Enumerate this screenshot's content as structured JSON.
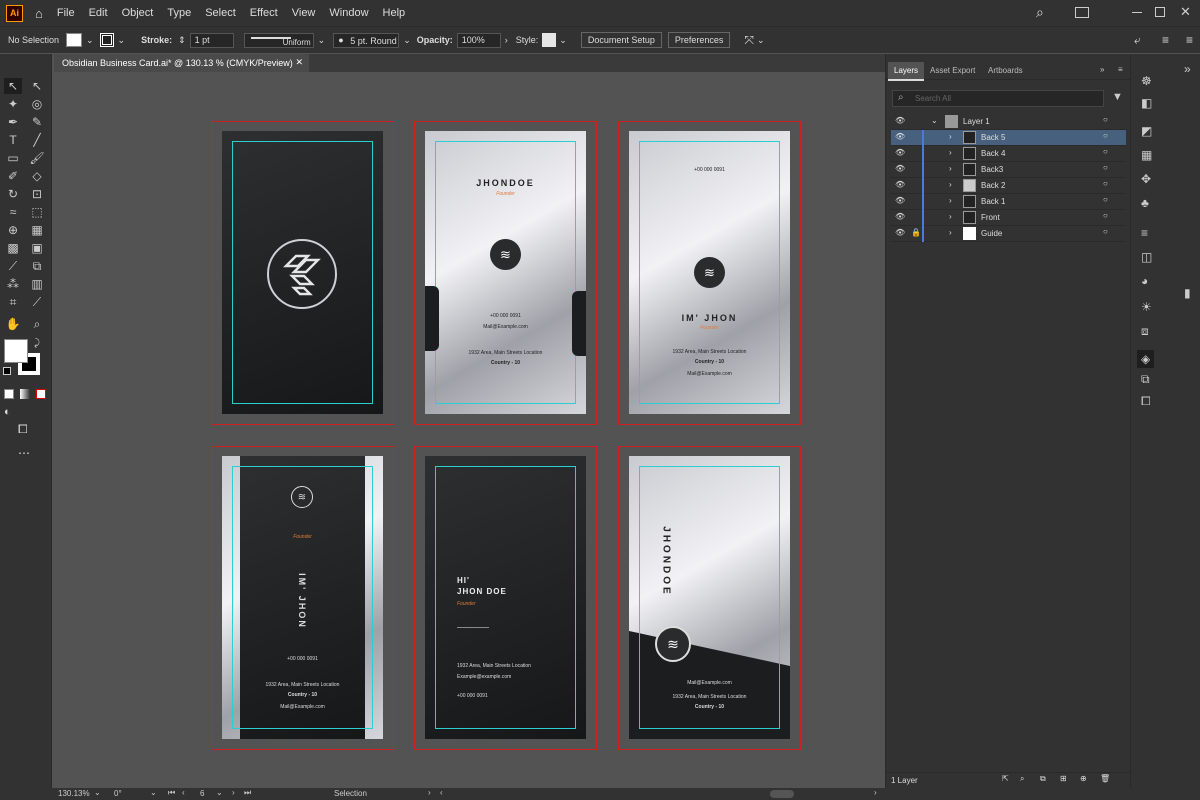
{
  "menu": [
    "File",
    "Edit",
    "Object",
    "Type",
    "Select",
    "Effect",
    "View",
    "Window",
    "Help"
  ],
  "control": {
    "selection": "No Selection",
    "stroke_label": "Stroke:",
    "stroke_value": "1 pt",
    "profile": "Uniform",
    "brush": "5 pt. Round",
    "opacity_label": "Opacity:",
    "opacity_value": "100%",
    "style_label": "Style:",
    "doc_setup": "Document Setup",
    "prefs": "Preferences"
  },
  "document_tab": "Obsidian Business Card.ai* @ 130.13 % (CMYK/Preview)",
  "cards": {
    "a2_name": "JHONDOE",
    "a2_title": "Founder",
    "a2_phone": "+00 000 0091",
    "a2_mail": "Mail@Example.com",
    "a2_addr": "1932 Area, Main Streets Location",
    "a2_country": "Country - 10",
    "a3_phone": "+00 000 0091",
    "a3_name": "IM' JHON",
    "a3_title": "Founder",
    "a3_addr": "1932 Area, Main Streets Location",
    "a3_country": "Country - 10",
    "a3_mail": "Mail@Example.com",
    "a4_title": "Founder",
    "a4_name": "IM' JHON",
    "a4_phone": "+00 000 0091",
    "a4_addr": "1932 Area, Main Streets Location",
    "a4_country": "Country - 10",
    "a4_mail": "Mail@Example.com",
    "a5_hi": "HI'",
    "a5_name": "JHON DOE",
    "a5_title": "Founder",
    "a5_addr": "1932 Area, Main Streets Location",
    "a5_mail": "Example@example.com",
    "a5_phone": "+00 000 0091",
    "a6_name": "JHONDOE",
    "a6_mail": "Mail@Example.com",
    "a6_addr": "1932 Area, Main Streets Location",
    "a6_country": "Country - 10"
  },
  "panel": {
    "tabs": [
      "Layers",
      "Asset Export",
      "Artboards"
    ],
    "search_placeholder": "Search All",
    "layers": [
      {
        "name": "Layer 1",
        "selected": false
      },
      {
        "name": "Back 5",
        "selected": true
      },
      {
        "name": "Back 4",
        "selected": false
      },
      {
        "name": "Back3",
        "selected": false
      },
      {
        "name": "Back 2",
        "selected": false
      },
      {
        "name": "Back 1",
        "selected": false
      },
      {
        "name": "Front",
        "selected": false
      },
      {
        "name": "Guide",
        "selected": false
      }
    ],
    "footer": "1 Layer"
  },
  "status": {
    "zoom": "130.13%",
    "rotation": "0°",
    "artboard": "6",
    "tool": "Selection"
  },
  "colors": {
    "accent": "#2ccfcf",
    "artboard_border": "#d02020",
    "selected_layer": "#46607e",
    "layer_color": "#4b7bd6"
  }
}
